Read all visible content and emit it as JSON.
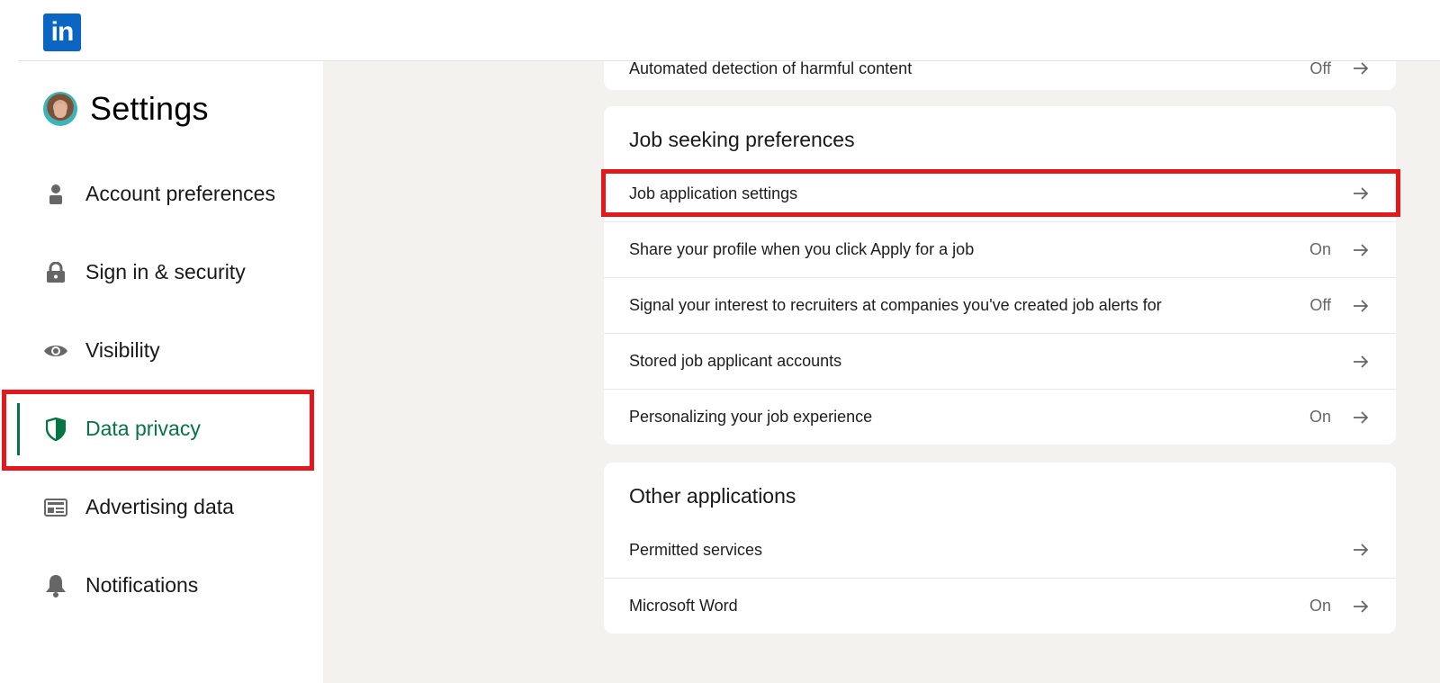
{
  "header": {
    "logo_text": "in",
    "logo_color": "#0a66c2"
  },
  "sidebar": {
    "title": "Settings",
    "items": [
      {
        "label": "Account preferences",
        "icon": "person-icon",
        "active": false
      },
      {
        "label": "Sign in & security",
        "icon": "lock-icon",
        "active": false
      },
      {
        "label": "Visibility",
        "icon": "eye-icon",
        "active": false
      },
      {
        "label": "Data privacy",
        "icon": "shield-icon",
        "active": true
      },
      {
        "label": "Advertising data",
        "icon": "ad-card-icon",
        "active": false
      },
      {
        "label": "Notifications",
        "icon": "bell-icon",
        "active": false
      }
    ],
    "active_color": "#057642"
  },
  "main": {
    "previous_section": {
      "rows": [
        {
          "label": "Automated detection of harmful content",
          "value": "Off"
        }
      ]
    },
    "job_seeking": {
      "title": "Job seeking preferences",
      "rows": [
        {
          "label": "Job application settings",
          "value": ""
        },
        {
          "label": "Share your profile when you click Apply for a job",
          "value": "On"
        },
        {
          "label": "Signal your interest to recruiters at companies you've created job alerts for",
          "value": "Off"
        },
        {
          "label": "Stored job applicant accounts",
          "value": ""
        },
        {
          "label": "Personalizing your job experience",
          "value": "On"
        }
      ]
    },
    "other_applications": {
      "title": "Other applications",
      "rows": [
        {
          "label": "Permitted services",
          "value": ""
        },
        {
          "label": "Microsoft Word",
          "value": "On"
        }
      ]
    }
  },
  "highlight_color": "#e4171d"
}
